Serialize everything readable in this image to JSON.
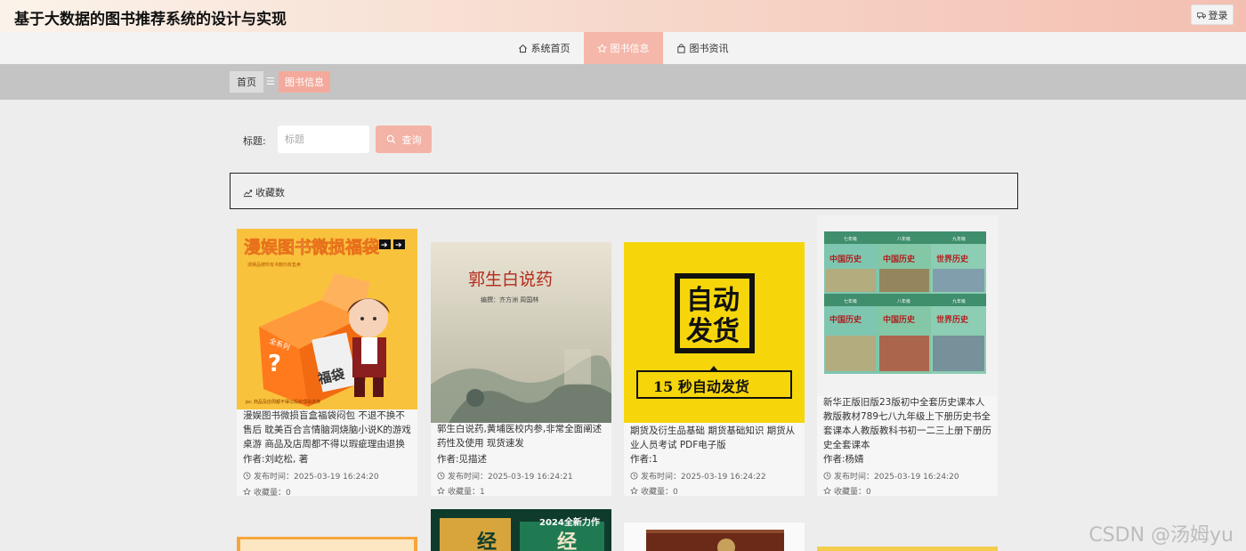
{
  "header": {
    "title": "基于大数据的图书推荐系统的设计与实现",
    "login_label": "登录"
  },
  "nav": {
    "items": [
      {
        "label": "系统首页",
        "icon": "home-icon"
      },
      {
        "label": "图书信息",
        "icon": "star-icon",
        "active": true
      },
      {
        "label": "图书资讯",
        "icon": "bag-icon"
      }
    ]
  },
  "breadcrumb": {
    "home": "首页",
    "separator": "☰",
    "current": "图书信息"
  },
  "search": {
    "label": "标题:",
    "placeholder": "标题",
    "button_label": "查询"
  },
  "sort": {
    "label": "收藏数"
  },
  "colors": {
    "accent": "#f4b7aa",
    "nav_bg": "#f3f3f3",
    "crumb_bg": "#c4c4c4"
  },
  "cards": [
    {
      "title": "漫娱图书微损盲盒福袋闷包 不退不换不售后 耽美百合言情脑洞烧脑小说K的游戏桌游 商品及店周都不得以瑕疵理由退换",
      "author": "作者:刘屹松, 著",
      "published": "发布时间：2025-03-19 16:24:20",
      "favorites": "收藏量：0",
      "cover": {
        "banner": "漫娱图书微损福袋",
        "box_text": "福袋",
        "box_tag": "全系列",
        "subtext": "漫娱品牌所有书籍均有售卖",
        "footer": "ps: 商品及店周都不得以瑕疵理由退换"
      }
    },
    {
      "title": "郭生白说药,黄埔医校内参,非常全面阐述药性及使用 现货速发",
      "author": "作者:见描述",
      "published": "发布时间：2025-03-19 16:24:21",
      "favorites": "收藏量：1",
      "cover": {
        "book_title": "郭生白说药",
        "editors": "编撰：齐方洲  周国林"
      }
    },
    {
      "title": "期货及衍生品基础 期货基础知识 期货从业人员考试 PDF电子版",
      "author": "作者:1",
      "published": "发布时间：2025-03-19 16:24:22",
      "favorites": "收藏量：0",
      "cover": {
        "line1": "自动",
        "line2": "发货",
        "bottom": "15 秒自动发货"
      }
    },
    {
      "title": "新华正版旧版23版初中全套历史课本人教版教材789七八九年级上下册历史书全套课本人教版教科书初一二三上册下册历史全套课本",
      "author": "作者:杨婧",
      "published": "发布时间：2025-03-19 16:24:20",
      "favorites": "收藏量：0",
      "cover": {
        "book_labels": [
          "中国历史",
          "中国历史",
          "世界历史",
          "中国历史",
          "中国历史",
          "世界历史"
        ],
        "grades": [
          "七年级",
          "八年级",
          "九年级",
          "七年级",
          "八年级",
          "九年级"
        ]
      }
    }
  ],
  "second_row_covers": {
    "card6_badge": "2024全新力作",
    "card6_title_char": "经"
  },
  "watermark": "CSDN @汤姆yu"
}
